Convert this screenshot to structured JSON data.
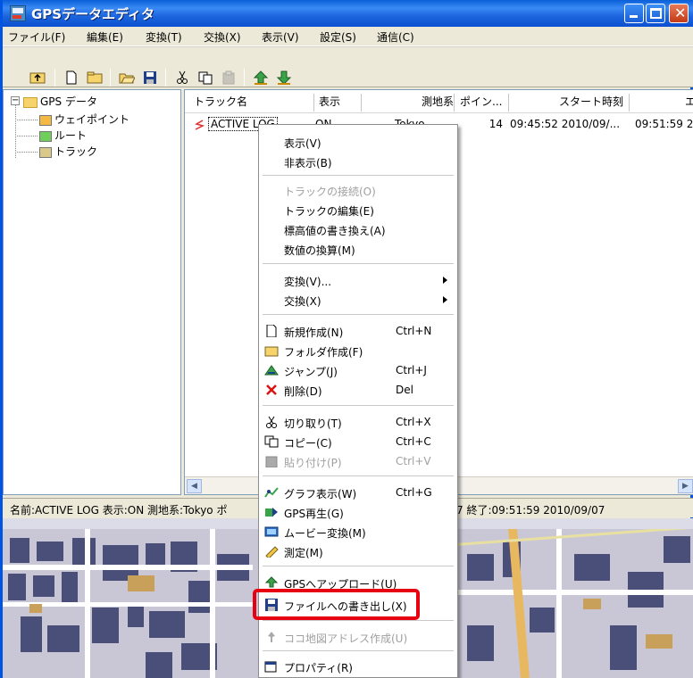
{
  "window": {
    "title": "GPSデータエディタ"
  },
  "menubar": {
    "items": [
      "ファイル(F)",
      "編集(E)",
      "変換(T)",
      "交換(X)",
      "表示(V)",
      "設定(S)",
      "通信(C)"
    ]
  },
  "toolbar": {
    "icons": [
      "up-folder-icon",
      "new-file-icon",
      "new-folder-icon",
      "open-icon",
      "save-icon",
      "cut-icon",
      "copy-icon",
      "paste-icon",
      "upload-icon",
      "download-icon"
    ]
  },
  "tree": {
    "root": "GPS データ",
    "children": [
      "ウェイポイント",
      "ルート",
      "トラック"
    ]
  },
  "list": {
    "headers": [
      "トラック名",
      "表示",
      "測地系",
      "ポイン...",
      "スタート時刻",
      "エ"
    ],
    "row": {
      "name": "ACTIVE LOG",
      "display": "ON",
      "datum": "Tokyo",
      "points": "14",
      "start": "09:45:52 2010/09/...",
      "end": "09:51:59 20"
    }
  },
  "statusbar": {
    "text": "名前:ACTIVE LOG 表示:ON 測地系:Tokyo ポ",
    "tail": "7 終了:09:51:59 2010/09/07"
  },
  "context_menu": {
    "items": [
      {
        "label": "表示(V)",
        "shortcut": "",
        "disabled": false,
        "submenu": false,
        "icon": ""
      },
      {
        "label": "非表示(B)",
        "shortcut": "",
        "disabled": false,
        "submenu": false,
        "icon": ""
      },
      {
        "label": "トラックの接続(O)",
        "shortcut": "",
        "disabled": true,
        "submenu": false,
        "icon": ""
      },
      {
        "label": "トラックの編集(E)",
        "shortcut": "",
        "disabled": false,
        "submenu": false,
        "icon": ""
      },
      {
        "label": "標高値の書き換え(A)",
        "shortcut": "",
        "disabled": false,
        "submenu": false,
        "icon": ""
      },
      {
        "label": "数値の換算(M)",
        "shortcut": "",
        "disabled": false,
        "submenu": false,
        "icon": ""
      },
      {
        "label": "変換(V)...",
        "shortcut": "",
        "disabled": false,
        "submenu": true,
        "icon": ""
      },
      {
        "label": "交換(X)",
        "shortcut": "",
        "disabled": false,
        "submenu": true,
        "icon": ""
      },
      {
        "label": "新規作成(N)",
        "shortcut": "Ctrl+N",
        "disabled": false,
        "submenu": false,
        "icon": "new-file-icon"
      },
      {
        "label": "フォルダ作成(F)",
        "shortcut": "",
        "disabled": false,
        "submenu": false,
        "icon": "new-folder-icon"
      },
      {
        "label": "ジャンプ(J)",
        "shortcut": "Ctrl+J",
        "disabled": false,
        "submenu": false,
        "icon": "jump-icon"
      },
      {
        "label": "削除(D)",
        "shortcut": "Del",
        "disabled": false,
        "submenu": false,
        "icon": "delete-icon"
      },
      {
        "label": "切り取り(T)",
        "shortcut": "Ctrl+X",
        "disabled": false,
        "submenu": false,
        "icon": "cut-icon"
      },
      {
        "label": "コピー(C)",
        "shortcut": "Ctrl+C",
        "disabled": false,
        "submenu": false,
        "icon": "copy-icon"
      },
      {
        "label": "貼り付け(P)",
        "shortcut": "Ctrl+V",
        "disabled": true,
        "submenu": false,
        "icon": "paste-icon"
      },
      {
        "label": "グラフ表示(W)",
        "shortcut": "Ctrl+G",
        "disabled": false,
        "submenu": false,
        "icon": "graph-icon"
      },
      {
        "label": "GPS再生(G)",
        "shortcut": "",
        "disabled": false,
        "submenu": false,
        "icon": "play-icon"
      },
      {
        "label": "ムービー変換(M)",
        "shortcut": "",
        "disabled": false,
        "submenu": false,
        "icon": "movie-icon"
      },
      {
        "label": "測定(M)",
        "shortcut": "",
        "disabled": false,
        "submenu": false,
        "icon": "measure-icon"
      },
      {
        "label": "GPSへアップロード(U)",
        "shortcut": "",
        "disabled": false,
        "submenu": false,
        "icon": "upload-icon"
      },
      {
        "label": "ファイルへの書き出し(X)",
        "shortcut": "",
        "disabled": false,
        "submenu": false,
        "icon": "save-icon"
      },
      {
        "label": "ココ地図アドレス作成(U)",
        "shortcut": "",
        "disabled": true,
        "submenu": false,
        "icon": "pin-icon"
      },
      {
        "label": "プロパティ(R)",
        "shortcut": "",
        "disabled": false,
        "submenu": false,
        "icon": "properties-icon"
      }
    ]
  },
  "colors": {
    "titlebar": "#0a5fd8",
    "highlight": "#e60012",
    "menu_bg": "#ece9d8"
  }
}
